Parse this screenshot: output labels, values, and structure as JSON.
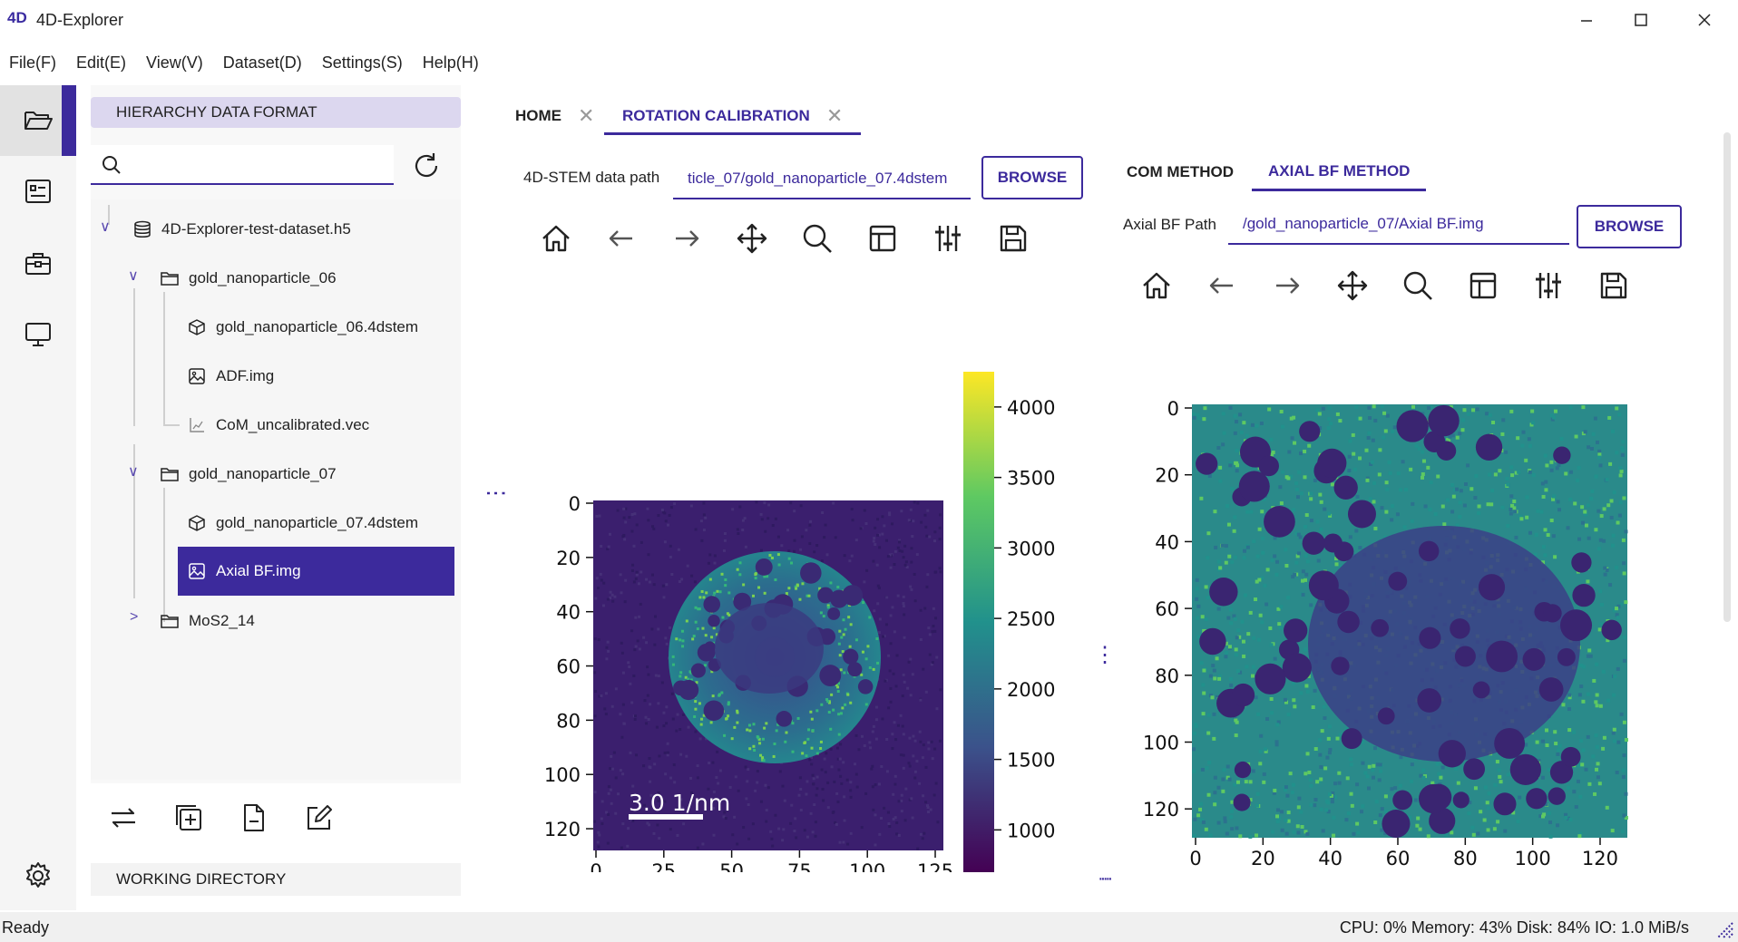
{
  "app": {
    "title": "4D-Explorer",
    "logo": "4D"
  },
  "menu": [
    "File(F)",
    "Edit(E)",
    "View(V)",
    "Dataset(D)",
    "Settings(S)",
    "Help(H)"
  ],
  "side": {
    "header": "HIERARCHY DATA FORMAT",
    "search_placeholder": "",
    "working_directory": "WORKING DIRECTORY",
    "tree": [
      {
        "label": "4D-Explorer-test-dataset.h5",
        "icon": "database-icon"
      },
      {
        "label": "gold_nanoparticle_06",
        "icon": "folder-icon"
      },
      {
        "label": "gold_nanoparticle_06.4dstem",
        "icon": "cube-icon"
      },
      {
        "label": "ADF.img",
        "icon": "image-icon"
      },
      {
        "label": "CoM_uncalibrated.vec",
        "icon": "vector-icon"
      },
      {
        "label": "gold_nanoparticle_07",
        "icon": "folder-icon"
      },
      {
        "label": "gold_nanoparticle_07.4dstem",
        "icon": "cube-icon"
      },
      {
        "label": "Axial BF.img",
        "icon": "image-icon"
      },
      {
        "label": "MoS2_14",
        "icon": "folder-icon"
      }
    ]
  },
  "tabs": [
    {
      "label": "HOME",
      "active": false
    },
    {
      "label": "ROTATION CALIBRATION",
      "active": true
    }
  ],
  "left_panel": {
    "path_label": "4D-STEM data path",
    "path_value": "ticle_07/gold_nanoparticle_07.4dstem",
    "browse": "BROWSE",
    "scalebar": "3.0 1/nm",
    "colorbar_ticks": [
      "4000",
      "3500",
      "3000",
      "2500",
      "2000",
      "1500",
      "1000"
    ],
    "x_ticks": [
      "0",
      "25",
      "50",
      "75",
      "100",
      "125"
    ],
    "y_ticks": [
      "0",
      "20",
      "40",
      "60",
      "80",
      "100",
      "120"
    ]
  },
  "right_panel": {
    "subtabs": [
      {
        "label": "COM METHOD",
        "active": false
      },
      {
        "label": "AXIAL BF METHOD",
        "active": true
      }
    ],
    "path_label": "Axial BF Path",
    "path_value": "/gold_nanoparticle_07/Axial BF.img",
    "browse": "BROWSE",
    "x_ticks": [
      "0",
      "20",
      "40",
      "60",
      "80",
      "100",
      "120"
    ],
    "y_ticks": [
      "0",
      "20",
      "40",
      "60",
      "80",
      "100",
      "120"
    ]
  },
  "toolbar_icons": [
    "home-icon",
    "back-icon",
    "forward-icon",
    "pan-icon",
    "zoom-icon",
    "subplots-icon",
    "configure-icon",
    "save-icon"
  ],
  "status": {
    "left": "Ready",
    "right": "CPU: 0%  Memory: 43%  Disk: 84%  IO: 1.0 MiB/s"
  },
  "colors": {
    "accent": "#3c2a9c",
    "selected_bg": "#3c2a9c",
    "header_bg": "#dcd7ef",
    "viridis_dark": "#3b1e6e",
    "viridis_mid": "#22908c",
    "viridis_bright": "#fde725"
  }
}
